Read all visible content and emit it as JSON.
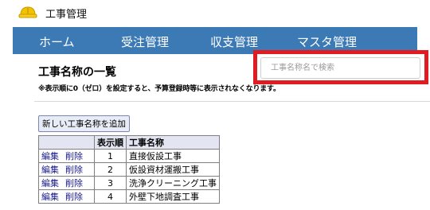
{
  "app": {
    "title": "工事管理",
    "logo_icon": "hard-hat-icon"
  },
  "nav": {
    "items": [
      {
        "label": "ホーム"
      },
      {
        "label": "受注管理"
      },
      {
        "label": "収支管理"
      },
      {
        "label": "マスタ管理"
      }
    ]
  },
  "page": {
    "heading": "工事名称の一覧",
    "notice": "※表示順に0（ゼロ）を設定すると、予算登録時等に表示されなくなります。"
  },
  "search": {
    "placeholder": "工事名称名で検索",
    "value": "",
    "highlight_color": "#e01b22"
  },
  "toolbar": {
    "add_label": "新しい工事名称を追加"
  },
  "table": {
    "headers": {
      "actions": "",
      "order": "表示順",
      "name": "工事名称"
    },
    "edit_label": "編集",
    "delete_label": "削除",
    "rows": [
      {
        "order": "1",
        "name": "直接仮設工事"
      },
      {
        "order": "2",
        "name": "仮設資材運搬工事"
      },
      {
        "order": "3",
        "name": "洗浄クリーニング工事"
      },
      {
        "order": "4",
        "name": "外壁下地調査工事"
      }
    ]
  },
  "colors": {
    "nav_bg": "#3c7ab5",
    "header_bg": "#e3e6f2",
    "button_bg": "#e8ecf7"
  }
}
